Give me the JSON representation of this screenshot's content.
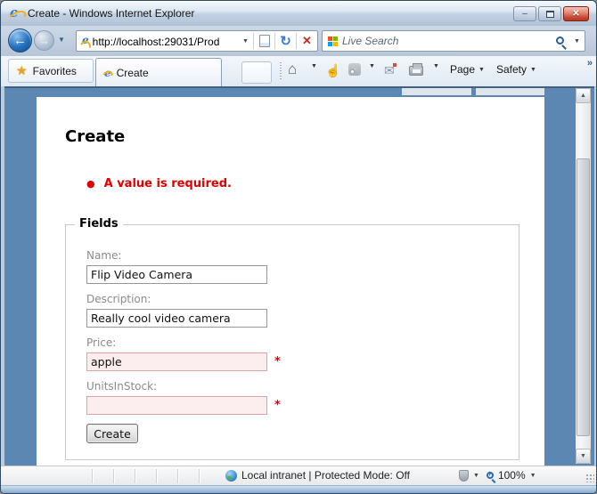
{
  "window": {
    "title": "Create - Windows Internet Explorer"
  },
  "navigation": {
    "url": "http://localhost:29031/Prod",
    "search_placeholder": "Live Search"
  },
  "tab_bar": {
    "favorites_label": "Favorites",
    "active_tab_label": "Create",
    "page_menu_label": "Page",
    "safety_menu_label": "Safety"
  },
  "page": {
    "heading": "Create",
    "validation_errors": [
      "A value is required."
    ],
    "fieldset_legend": "Fields",
    "fields": [
      {
        "label": "Name:",
        "value": "Flip Video Camera",
        "invalid": false
      },
      {
        "label": "Description:",
        "value": "Really cool video camera",
        "invalid": false
      },
      {
        "label": "Price:",
        "value": "apple",
        "invalid": true
      },
      {
        "label": "UnitsInStock:",
        "value": "",
        "invalid": true
      }
    ],
    "required_marker": "*",
    "submit_button_label": "Create"
  },
  "status_bar": {
    "zone_text": "Local intranet | Protected Mode: Off",
    "zoom_level": "100%"
  },
  "icons": {
    "back": "←",
    "forward": "→",
    "chevron_down": "▼",
    "refresh": "↻",
    "stop": "✕",
    "star": "★",
    "home": "⌂",
    "hand": "☝",
    "mail": "✉",
    "more": "»",
    "scroll_up": "▲",
    "scroll_down": "▼",
    "bullet": "●",
    "minimize": "–",
    "close": "✕"
  },
  "colors": {
    "page_background": "#5c87b2",
    "error_red": "#e00000",
    "invalid_field_background": "#fceeee",
    "chrome_frame": "#b9cde2"
  }
}
